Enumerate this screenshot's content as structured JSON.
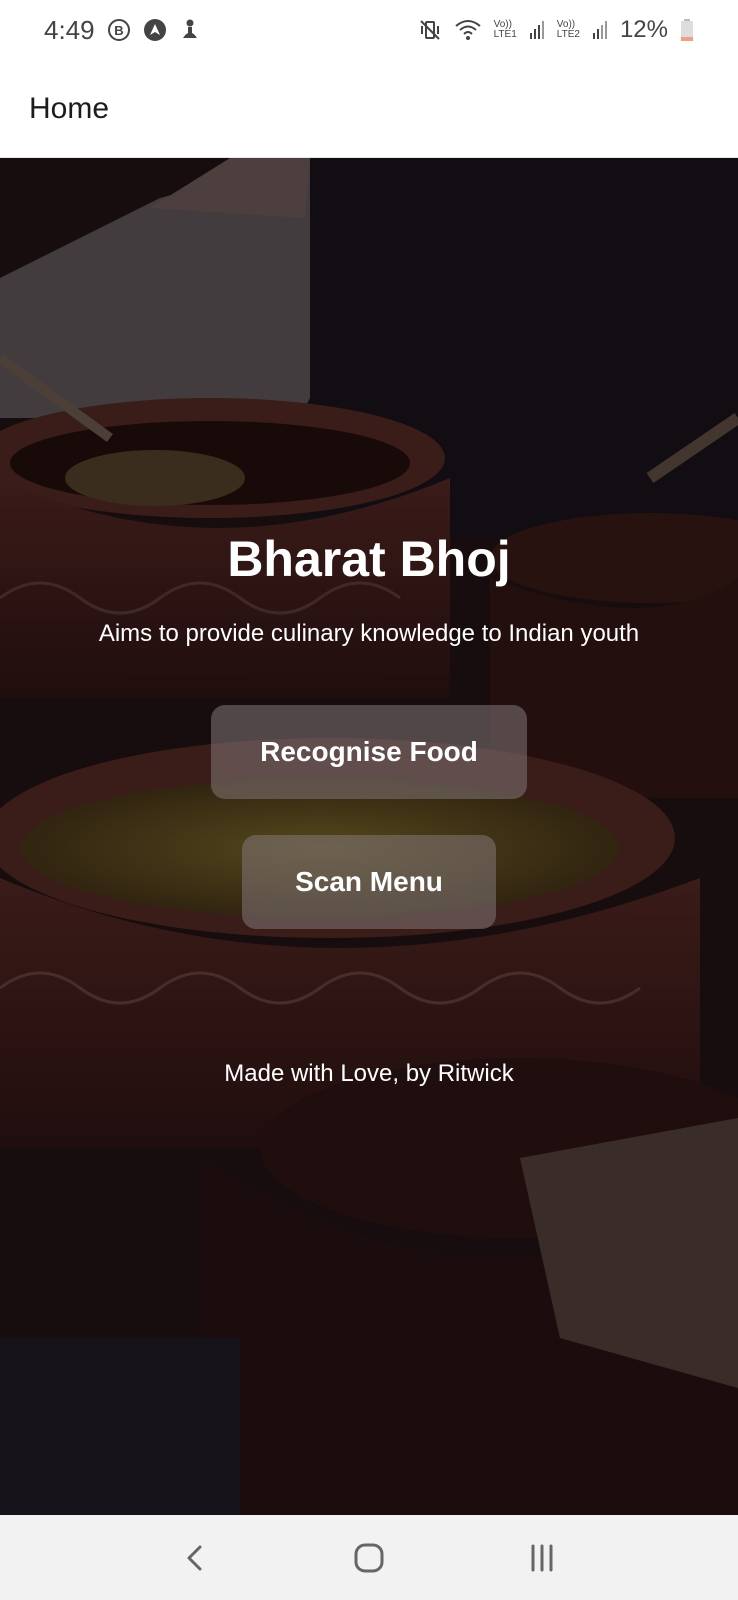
{
  "status_bar": {
    "time": "4:49",
    "net1_top": "Vo))",
    "net1_bottom": "LTE1",
    "net2_top": "Vo))",
    "net2_bottom": "LTE2",
    "battery": "12%",
    "icons": [
      "b-circle-icon",
      "navigation-arrow-icon",
      "accessibility-person-icon",
      "vibrate-mute-icon",
      "wifi-icon",
      "signal-icon",
      "battery-low-icon"
    ]
  },
  "app_bar": {
    "title": "Home"
  },
  "hero": {
    "title": "Bharat Bhoj",
    "tagline": "Aims to provide culinary knowledge to Indian youth",
    "buttons": {
      "recognise": "Recognise Food",
      "scan": "Scan Menu"
    },
    "credit": "Made with Love, by Ritwick"
  },
  "nav_bar": {
    "icons": [
      "back-icon",
      "home-icon",
      "recents-icon"
    ]
  },
  "colors": {
    "overlay": "#140a0e",
    "button_bg": "#827678",
    "text": "#ffffff",
    "nav_bg": "#f2f2f2"
  }
}
